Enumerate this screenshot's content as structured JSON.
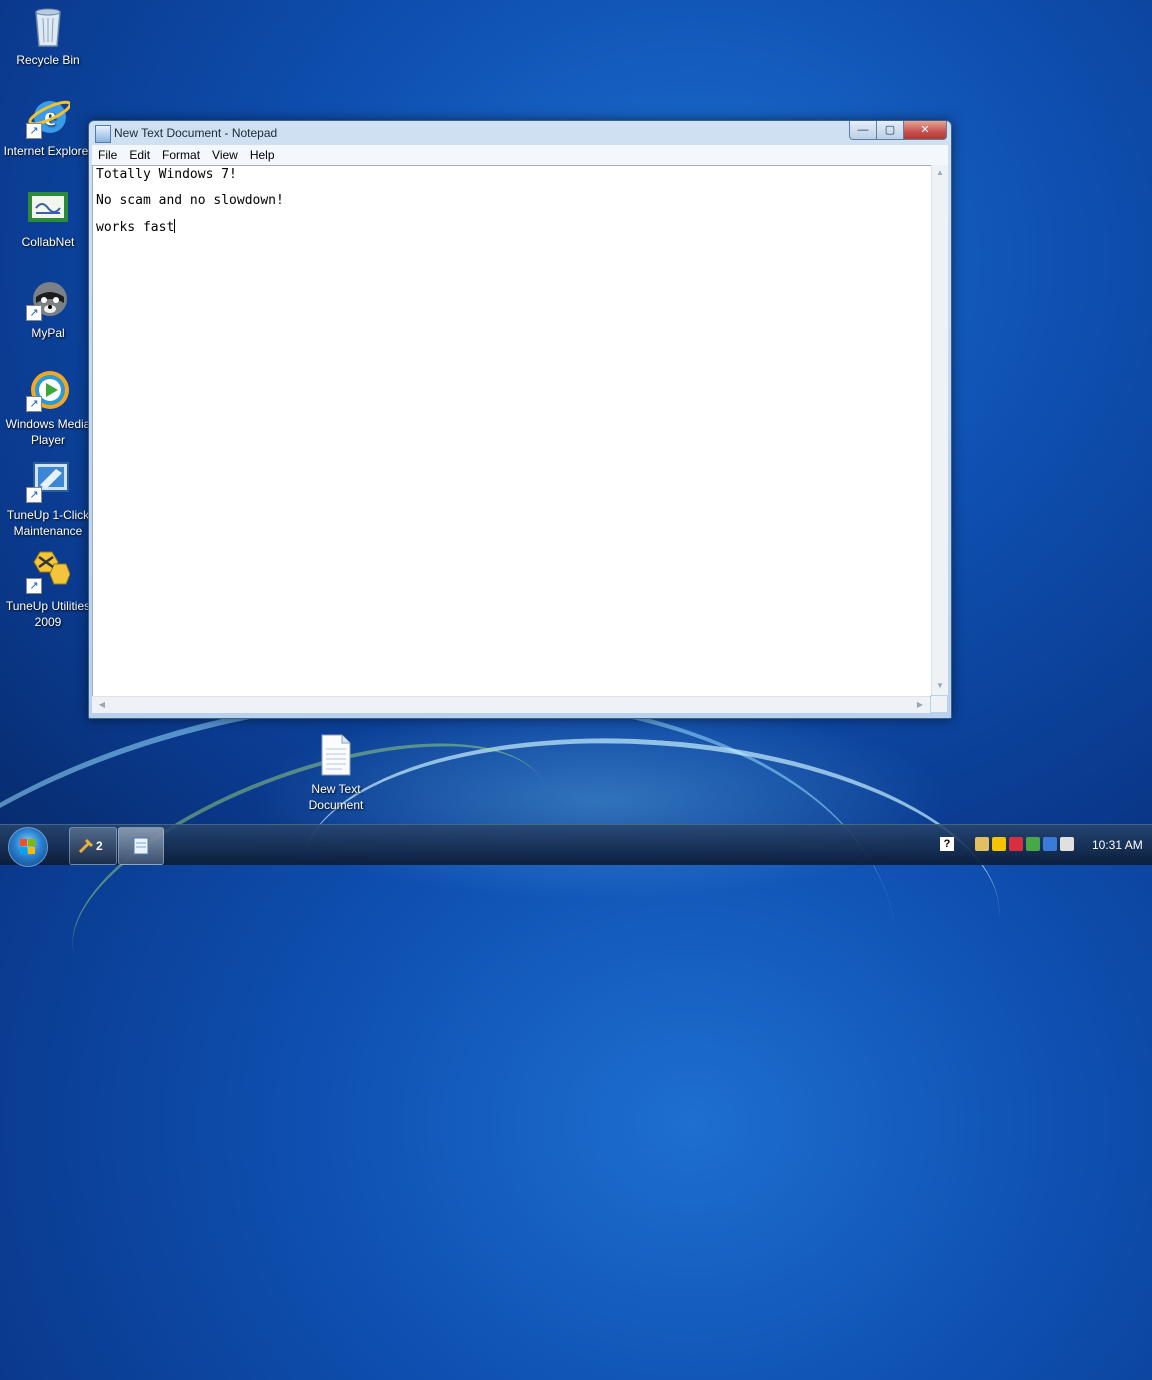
{
  "desktop": {
    "icons": [
      {
        "label": "Recycle Bin",
        "icon": "recycle-bin-icon"
      },
      {
        "label": "Internet Explorer",
        "icon": "internet-explorer-icon"
      },
      {
        "label": "CollabNet",
        "icon": "collabnet-icon"
      },
      {
        "label": "MyPal",
        "icon": "mypal-icon"
      },
      {
        "label": "Windows Media Player",
        "icon": "windows-media-player-icon"
      },
      {
        "label": "TuneUp 1-Click Maintenance",
        "icon": "tuneup-maintenance-icon"
      },
      {
        "label": "TuneUp Utilities 2009",
        "icon": "tuneup-utilities-icon"
      }
    ],
    "file_icon": {
      "label": "New Text Document",
      "icon": "text-document-icon"
    },
    "shortcut_glyph": "↗"
  },
  "notepad": {
    "title": "New Text Document - Notepad",
    "controls": {
      "minimize": "—",
      "maximize": "▢",
      "close": "✕"
    },
    "menu": [
      "File",
      "Edit",
      "Format",
      "View",
      "Help"
    ],
    "lines": [
      "Totally Windows 7!",
      "No scam and no slowdown!",
      "works fast"
    ],
    "scroll_arrows": {
      "up": "▲",
      "down": "▼",
      "left": "◀",
      "right": "▶"
    }
  },
  "taskbar": {
    "group_count": "2",
    "help_glyph": "?",
    "clock": "10:31 AM",
    "tray_colors": [
      "#e0c060",
      "#f4c400",
      "#d83040",
      "#48a848",
      "#3a7ad8",
      "#e0e0e0"
    ],
    "flag_colors": [
      "#f25022",
      "#7fba00",
      "#00a4ef",
      "#ffb900"
    ]
  }
}
